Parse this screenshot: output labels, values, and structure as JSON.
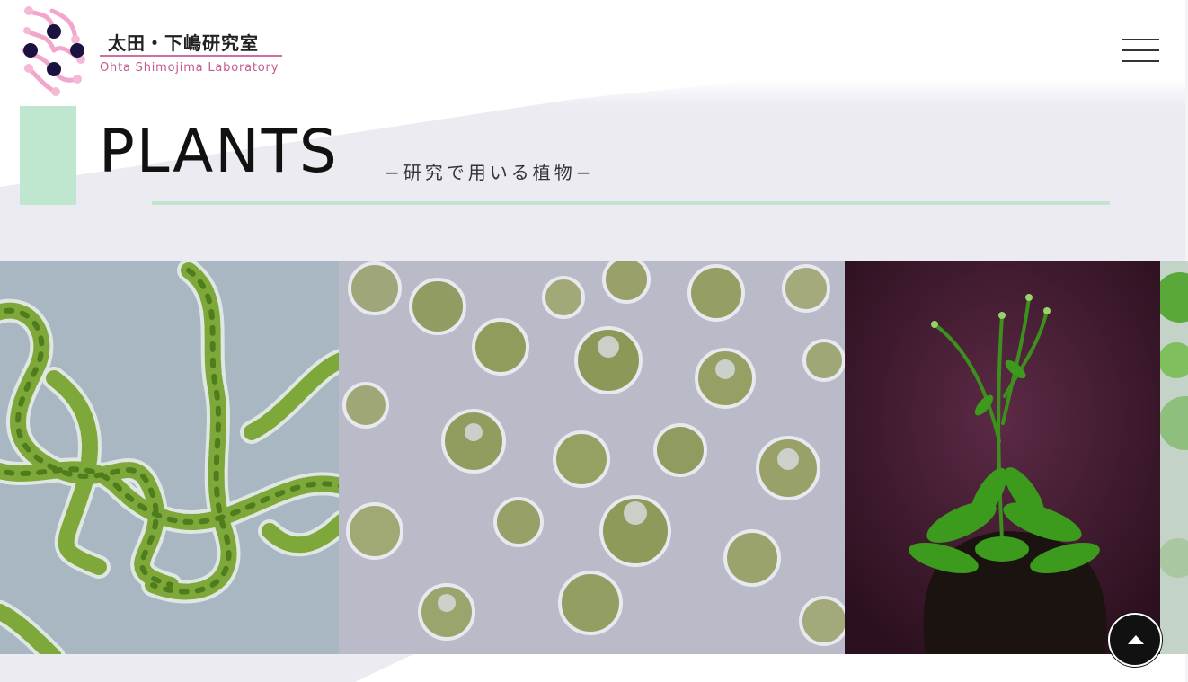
{
  "header": {
    "logo_title": "太田・下嶋研究室",
    "logo_subtitle": "Ohta Shimojima Laboratory",
    "menu_icon": "hamburger-menu-icon"
  },
  "page": {
    "heading": "PLANTS",
    "subheading": "−研究で用いる植物−"
  },
  "gallery": {
    "images": [
      "filamentous-algae-photo",
      "round-algae-cells-photo",
      "arabidopsis-plant-photo",
      "moss-photo"
    ]
  },
  "controls": {
    "back_to_top_icon": "triangle-up-icon"
  },
  "colors": {
    "accent_mint": "#bfe6cf",
    "accent_pink": "#cf6f9e",
    "logo_navy": "#1a1340",
    "background": "#ecebf2"
  }
}
